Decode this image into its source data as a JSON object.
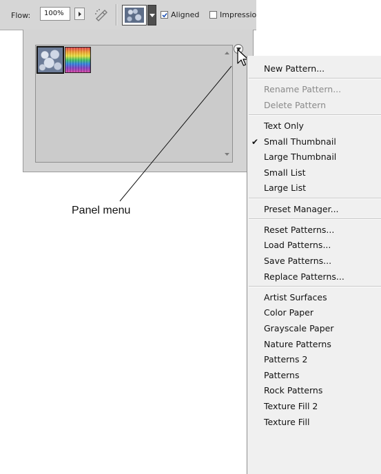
{
  "toolbar": {
    "flow_label": "Flow:",
    "flow_value": "100%",
    "aligned_label": "Aligned",
    "aligned_checked": true,
    "impressionist_label": "Impressio",
    "impressionist_checked": false
  },
  "panel": {
    "patterns": [
      {
        "name": "bubbles-pattern",
        "selected": true
      },
      {
        "name": "rainbow-pattern",
        "selected": false
      }
    ]
  },
  "callout": {
    "label": "Panel menu"
  },
  "menu": {
    "groups": [
      [
        {
          "label": "New Pattern...",
          "enabled": true,
          "checked": false
        }
      ],
      [
        {
          "label": "Rename Pattern...",
          "enabled": false,
          "checked": false
        },
        {
          "label": "Delete Pattern",
          "enabled": false,
          "checked": false
        }
      ],
      [
        {
          "label": "Text Only",
          "enabled": true,
          "checked": false
        },
        {
          "label": "Small Thumbnail",
          "enabled": true,
          "checked": true
        },
        {
          "label": "Large Thumbnail",
          "enabled": true,
          "checked": false
        },
        {
          "label": "Small List",
          "enabled": true,
          "checked": false
        },
        {
          "label": "Large List",
          "enabled": true,
          "checked": false
        }
      ],
      [
        {
          "label": "Preset Manager...",
          "enabled": true,
          "checked": false
        }
      ],
      [
        {
          "label": "Reset Patterns...",
          "enabled": true,
          "checked": false
        },
        {
          "label": "Load Patterns...",
          "enabled": true,
          "checked": false
        },
        {
          "label": "Save Patterns...",
          "enabled": true,
          "checked": false
        },
        {
          "label": "Replace Patterns...",
          "enabled": true,
          "checked": false
        }
      ],
      [
        {
          "label": "Artist Surfaces",
          "enabled": true,
          "checked": false
        },
        {
          "label": "Color Paper",
          "enabled": true,
          "checked": false
        },
        {
          "label": "Grayscale Paper",
          "enabled": true,
          "checked": false
        },
        {
          "label": "Nature Patterns",
          "enabled": true,
          "checked": false
        },
        {
          "label": "Patterns 2",
          "enabled": true,
          "checked": false
        },
        {
          "label": "Patterns",
          "enabled": true,
          "checked": false
        },
        {
          "label": "Rock Patterns",
          "enabled": true,
          "checked": false
        },
        {
          "label": "Texture Fill 2",
          "enabled": true,
          "checked": false
        },
        {
          "label": "Texture Fill",
          "enabled": true,
          "checked": false
        }
      ]
    ],
    "check_glyph": "✔",
    "colors": {
      "text": "#111111",
      "disabled_text": "#8a8a8a",
      "background": "#f0f0f0"
    }
  }
}
